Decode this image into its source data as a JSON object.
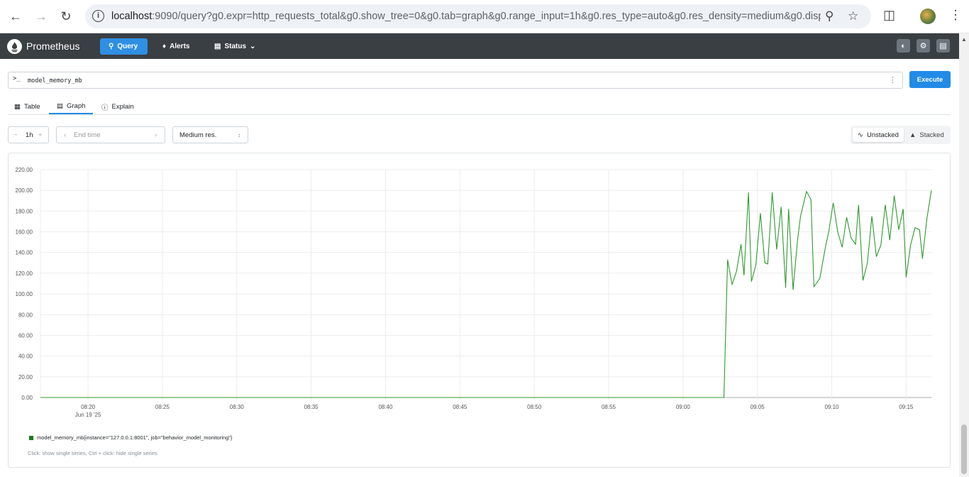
{
  "browser": {
    "url_host": "localhost",
    "url_rest": ":9090/query?g0.expr=http_requests_total&g0.show_tree=0&g0.tab=graph&g0.range_input=1h&g0.res_type=auto&g0.res_density=medium&g0.displ..."
  },
  "app": {
    "brand": "Prometheus",
    "nav": {
      "query": "Query",
      "alerts": "Alerts",
      "status": "Status"
    }
  },
  "query": {
    "prompt": ">_",
    "expression": "model_memory_mb",
    "execute_label": "Execute"
  },
  "tabs": {
    "table": "Table",
    "graph": "Graph",
    "explain": "Explain"
  },
  "controls": {
    "range": "1h",
    "end_time_placeholder": "End time",
    "resolution": "Medium res.",
    "unstacked": "Unstacked",
    "stacked": "Stacked"
  },
  "legend": {
    "series_label": "model_memory_mb{instance=\"127.0.0.1:8001\", job=\"behavior_model_monitoring\"}",
    "hint": "Click: show single series, Ctrl + click: hide single series"
  },
  "colors": {
    "series": "#2e9a2e",
    "accent": "#228be6",
    "navbar": "#3a3f44"
  },
  "chart_data": {
    "type": "line",
    "x_tick_labels": [
      "08:20",
      "08:25",
      "08:30",
      "08:35",
      "08:40",
      "08:45",
      "08:50",
      "08:55",
      "09:00",
      "09:05",
      "09:10",
      "09:15"
    ],
    "x_subtitle": "Jun 19 '25",
    "x_range_minutes": [
      16.8,
      76.7
    ],
    "y_tick_labels": [
      "0.00",
      "20.00",
      "40.00",
      "60.00",
      "80.00",
      "100.00",
      "120.00",
      "140.00",
      "160.00",
      "180.00",
      "200.00",
      "220.00"
    ],
    "ylim": [
      0,
      220
    ],
    "grid": true,
    "series": [
      {
        "name": "model_memory_mb{instance=\"127.0.0.1:8001\", job=\"behavior_model_monitoring\"}",
        "x_minutes": [
          16.8,
          62.75,
          63.0,
          63.3,
          63.6,
          63.9,
          64.1,
          64.4,
          64.6,
          64.9,
          65.2,
          65.5,
          65.7,
          66.0,
          66.3,
          66.6,
          66.9,
          67.1,
          67.4,
          67.7,
          67.9,
          68.3,
          68.6,
          68.8,
          69.2,
          69.6,
          69.8,
          70.1,
          70.4,
          70.7,
          71.0,
          71.3,
          71.6,
          71.8,
          72.1,
          72.4,
          72.7,
          73.0,
          73.3,
          73.6,
          73.9,
          74.2,
          74.5,
          74.8,
          75.0,
          75.3,
          75.6,
          75.9,
          76.1,
          76.4,
          76.7
        ],
        "values": [
          0,
          0,
          133,
          109,
          122,
          148,
          118,
          198,
          112,
          128,
          178,
          130,
          129,
          198,
          143,
          184,
          106,
          182,
          104,
          152,
          175,
          199,
          191,
          107,
          115,
          147,
          160,
          188,
          160,
          145,
          174,
          154,
          148,
          186,
          113,
          130,
          175,
          136,
          147,
          186,
          152,
          195,
          162,
          182,
          116,
          147,
          164,
          162,
          134,
          173,
          200
        ]
      }
    ]
  }
}
